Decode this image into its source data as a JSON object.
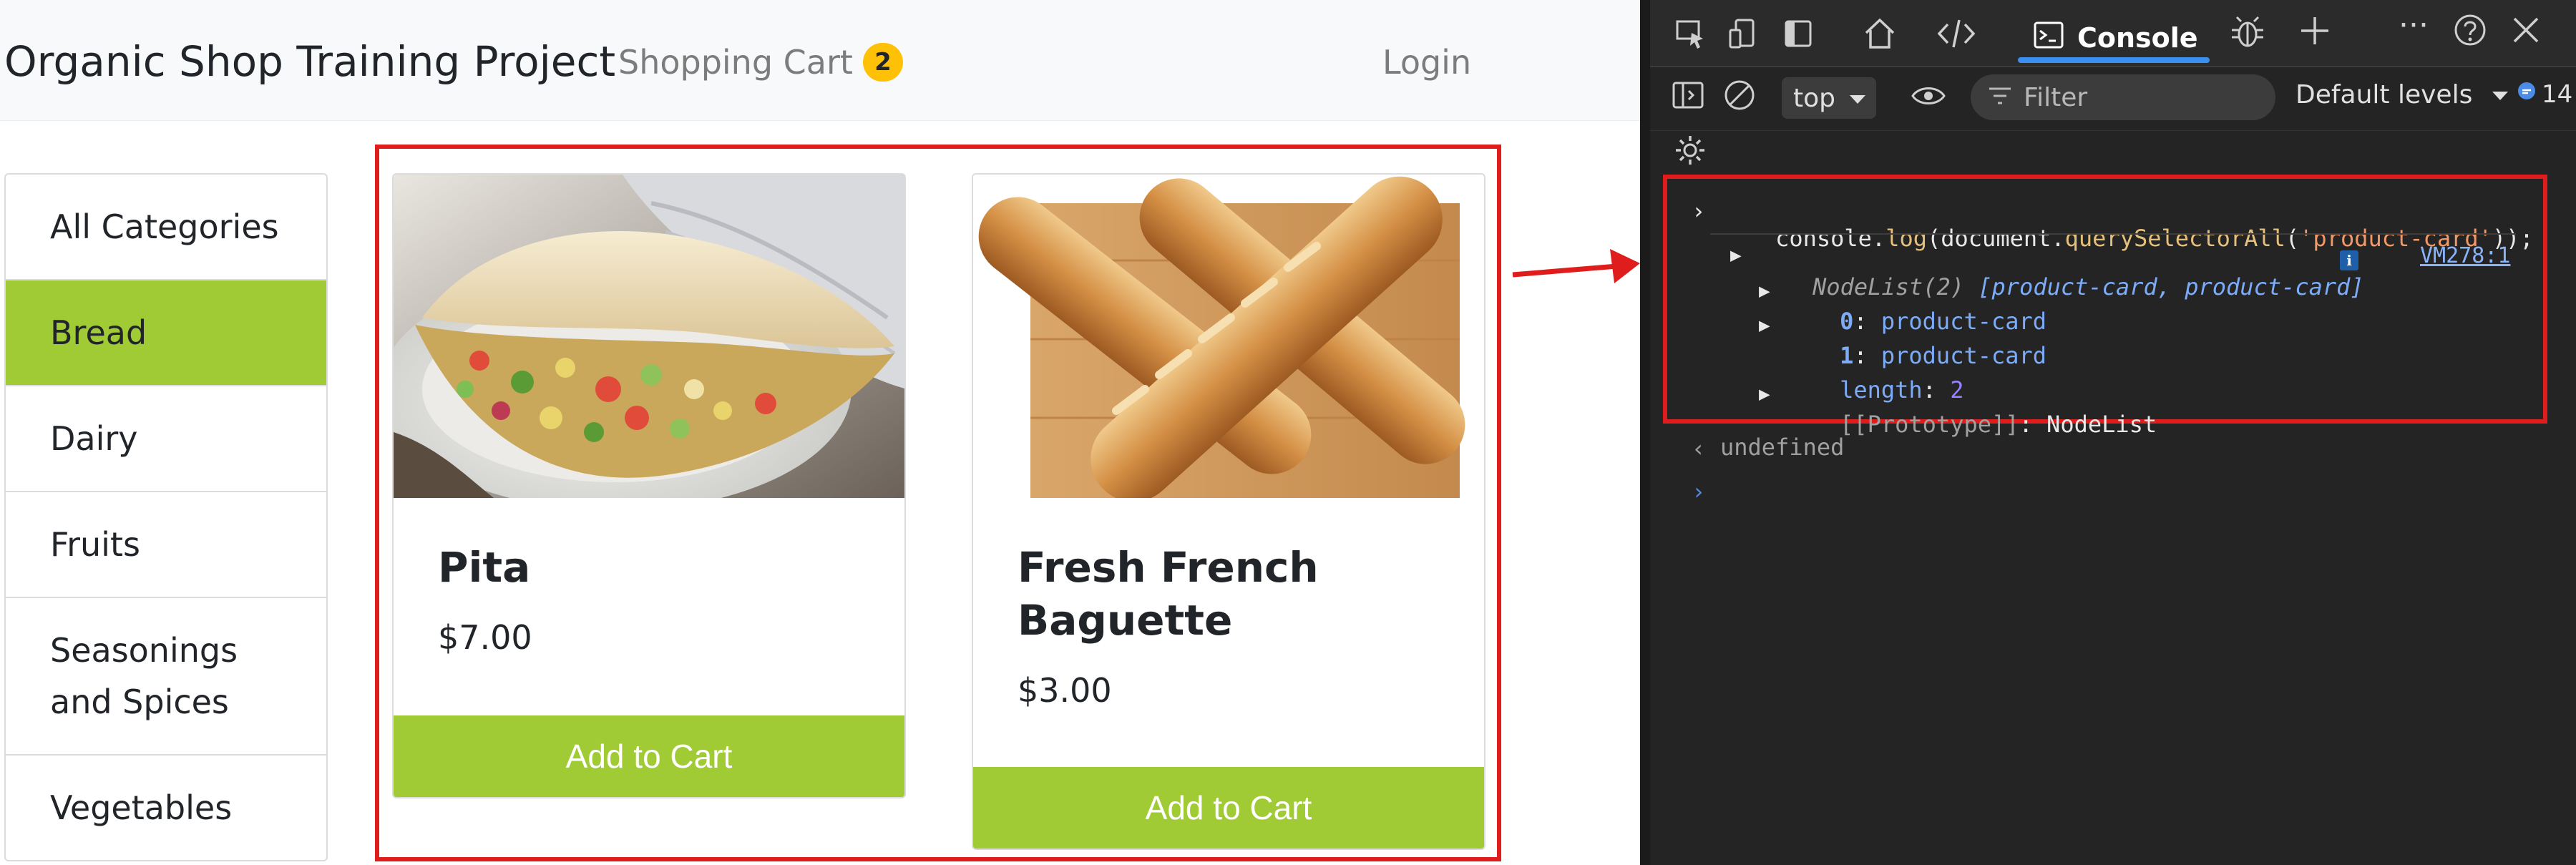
{
  "site": {
    "brand": "Organic Shop Training Project",
    "cart_label": "Shopping Cart",
    "cart_count": "2",
    "login_label": "Login",
    "categories": [
      {
        "label": "All Categories",
        "active": false
      },
      {
        "label": "Bread",
        "active": true
      },
      {
        "label": "Dairy",
        "active": false
      },
      {
        "label": "Fruits",
        "active": false
      },
      {
        "label": "Seasonings and Spices",
        "active": false
      },
      {
        "label": "Vegetables",
        "active": false
      }
    ],
    "products": [
      {
        "title": "Pita",
        "price": "$7.00",
        "button": "Add to Cart",
        "image": "pita-image"
      },
      {
        "title": "Fresh French Baguette",
        "price": "$3.00",
        "button": "Add to Cart",
        "image": "baguette-image"
      }
    ],
    "colors": {
      "accent": "#a0cb35",
      "badge": "#ffc107",
      "highlight": "#e01d1d"
    }
  },
  "devtools": {
    "tab_console": "Console",
    "context": "top",
    "filter_placeholder": "Filter",
    "levels": "Default levels",
    "message_count": "14",
    "input_prefix": "console.",
    "input_method": "log",
    "input_open": "(document.",
    "input_fn": "querySelectorAll",
    "input_open2": "(",
    "input_arg": "'product-card'",
    "input_close": "));",
    "nodelist_label": "NodeList(2)",
    "nodelist_items": "[product-card, product-card]",
    "source_link": "VM278:1",
    "item0_key": "0",
    "item0_val": "product-card",
    "item1_key": "1",
    "item1_val": "product-card",
    "length_key": "length",
    "length_val": "2",
    "proto_key": "[[Prototype]]",
    "proto_val": "NodeList",
    "result": "undefined",
    "icons": [
      "inspect-icon",
      "device-icon",
      "dock-icon",
      "home-icon",
      "elements-icon",
      "console-icon",
      "bug-icon",
      "add-tab-icon",
      "more-icon",
      "help-icon",
      "close-icon",
      "sidebar-icon",
      "clear-icon",
      "eye-icon",
      "settings-icon"
    ]
  }
}
